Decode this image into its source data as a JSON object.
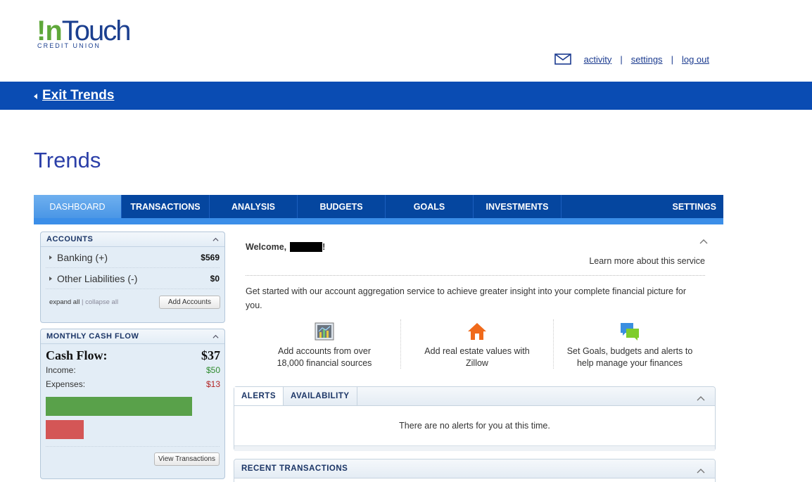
{
  "logo": {
    "brand_in": "!n",
    "brand_rest": "Touch",
    "sub": "CREDIT UNION"
  },
  "header_links": {
    "activity": "activity",
    "settings": "settings",
    "logout": "log out",
    "separator": "|"
  },
  "bluebar": {
    "exit_label": "Exit Trends"
  },
  "page_title": "Trends",
  "tabs": [
    {
      "label": "DASHBOARD",
      "active": true
    },
    {
      "label": "TRANSACTIONS"
    },
    {
      "label": "ANALYSIS"
    },
    {
      "label": "BUDGETS"
    },
    {
      "label": "GOALS"
    },
    {
      "label": "INVESTMENTS"
    },
    {
      "label": "SETTINGS"
    }
  ],
  "accounts": {
    "title": "ACCOUNTS",
    "items": [
      {
        "label": "Banking (+)",
        "amount": "$569"
      },
      {
        "label": "Other Liabilities (-)",
        "amount": "$0"
      }
    ],
    "expand_all": "expand all",
    "separator": "|",
    "collapse_all": "collapse all",
    "add_button": "Add Accounts"
  },
  "cash_flow": {
    "title": "MONTHLY CASH FLOW",
    "label": "Cash Flow:",
    "value": "$37",
    "income_label": "Income:",
    "income_value": "$50",
    "expenses_label": "Expenses:",
    "expenses_value": "$13",
    "income_fraction": 1.0,
    "expenses_fraction": 0.26,
    "view_button": "View Transactions"
  },
  "welcome": {
    "greeting": "Welcome,",
    "suffix": "!",
    "learn_more": "Learn more about this service",
    "intro": "Get started with our account aggregation service to achieve greater insight into your complete financial picture for you.",
    "features": [
      {
        "icon": "chart-icon",
        "text_1": "Add accounts from over",
        "text_2": "18,000 financial sources"
      },
      {
        "icon": "house-icon",
        "text_1": "Add real estate values with",
        "text_2": "Zillow"
      },
      {
        "icon": "chat-bubbles-icon",
        "text_1": "Set Goals, budgets and alerts to",
        "text_2": "help manage your finances"
      }
    ]
  },
  "alerts_box": {
    "tabs": [
      "ALERTS",
      "AVAILABILITY"
    ],
    "message": "There are no alerts for you at this time."
  },
  "recent_transactions": {
    "title": "RECENT TRANSACTIONS"
  },
  "colors": {
    "nav_blue": "#0a4cb3",
    "tab_bar": "#05469f",
    "income_green": "#59a14a",
    "expense_red": "#d45656",
    "title_blue": "#2b3fa8"
  }
}
